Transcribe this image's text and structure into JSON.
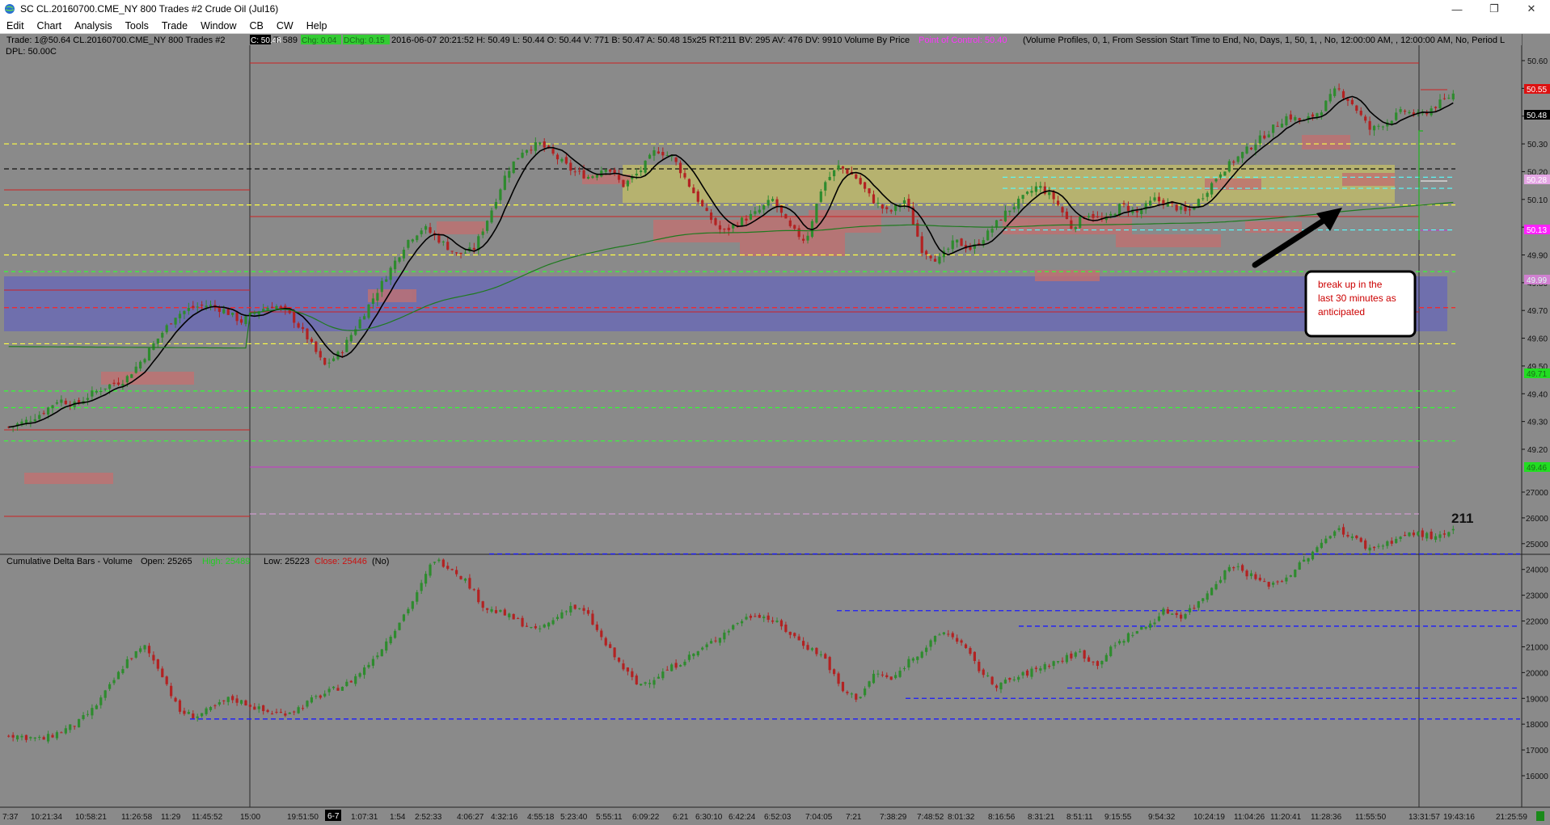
{
  "window": {
    "title": "SC CL.20160700.CME_NY  800 Trades  #2  Crude Oil (Jul16)",
    "min_glyph": "—",
    "max_glyph": "❐",
    "close_glyph": "✕"
  },
  "menu": [
    "Edit",
    "Chart",
    "Analysis",
    "Tools",
    "Trade",
    "Window",
    "CB",
    "CW",
    "Help"
  ],
  "info_bar": {
    "prefix": "Trade: 1@50.64  CL.20160700.CME_NY  800 Trades  #2",
    "c_badge": "C: 50.48",
    "t_text": "T: 589",
    "chg_badge": "Chg: 0.04",
    "dchg_badge": "DChg: 0.15",
    "details": "2016-06-07 20:21:52  H: 50.49  L: 50.44  O: 50.44  V: 771  B: 50.47  A: 50.48  15x25  RT:211  BV: 295  AV: 476  DV: 9910  Volume By Price",
    "poc": "Point of Control: 50.40",
    "profile": "(Volume Profiles, 0, 1, From Session Start Time to End, No, Days, 1, 50, 1, , No, 12:00:00 AM, , 12:00:00 AM, No, Period L",
    "dpl": "DPL: 50.00C"
  },
  "annotation": {
    "text_lines": [
      "break up in the",
      "last 30 minutes as",
      "anticipated"
    ],
    "bar_counter": "211"
  },
  "price_labels": {
    "red": "50.55",
    "last": "50.48",
    "pink": "50.28",
    "magenta": "50.13",
    "cyan": "49.99",
    "red2": "49.71",
    "green": "49.46"
  },
  "lower_pane": {
    "title": "Cumulative Delta Bars - Volume",
    "open": "Open: 25265",
    "high": "High: 25489",
    "low": "Low: 25223",
    "close": "Close: 25446",
    "no": "(No)"
  },
  "time_axis": {
    "labels": [
      "7:37",
      "10:21:34",
      "10:58:21",
      "11:26:58",
      "11:29",
      "11:45:52",
      "15:00",
      "19:51:50",
      "6-7",
      "1:07:31",
      "1:54",
      "2:52:33",
      "4:06:27",
      "4:32:16",
      "4:55:18",
      "5:23:40",
      "5:55:11",
      "6:09:22",
      "6:21",
      "6:30:10",
      "6:42:24",
      "6:52:03",
      "7:04:05",
      "7:21",
      "7:38:29",
      "7:48:52",
      "8:01:32",
      "8:16:56",
      "8:31:21",
      "8:51:11",
      "9:15:55",
      "9:54:32",
      "10:24:19",
      "11:04:26",
      "11:20:41",
      "11:28:36",
      "11:55:50",
      "13:31:57",
      "19:43:16",
      "21:25:59"
    ]
  },
  "colors": {
    "chart_bg": "#8a8a8a",
    "up_candle": "#2e8b2e",
    "down_candle": "#b22222",
    "value_area": "#6b6bb0",
    "yellow_zone": "#bdb86a",
    "volume_block": "#c07070",
    "ma_line": "#000000",
    "vwap_line": "#1f7a1f"
  },
  "chart_data": [
    {
      "type": "candlestick",
      "title": "CL.20160700.CME_NY 800 Trades #2",
      "ylim": [
        49.18,
        50.68
      ],
      "y_ticks": [
        "50.60",
        "50.50",
        "50.40",
        "50.30",
        "50.20",
        "50.10",
        "50.00",
        "49.90",
        "49.80",
        "49.70",
        "49.60",
        "49.50",
        "49.40",
        "49.30",
        "49.20"
      ],
      "close_path": [
        49.28,
        49.3,
        49.33,
        49.38,
        49.36,
        49.4,
        49.43,
        49.45,
        49.52,
        49.6,
        49.68,
        49.71,
        49.72,
        49.7,
        49.66,
        49.7,
        49.72,
        49.68,
        49.6,
        49.5,
        49.55,
        49.65,
        49.75,
        49.85,
        49.95,
        50.0,
        49.95,
        49.9,
        49.92,
        50.05,
        50.2,
        50.28,
        50.3,
        50.25,
        50.2,
        50.18,
        50.22,
        50.15,
        50.2,
        50.28,
        50.25,
        50.15,
        50.05,
        49.98,
        50.02,
        50.05,
        50.1,
        50.0,
        49.95,
        50.15,
        50.22,
        50.18,
        50.1,
        50.05,
        50.1,
        49.92,
        49.88,
        49.95,
        49.92,
        49.98,
        50.05,
        50.1,
        50.15,
        50.1,
        50.0,
        50.05,
        50.02,
        50.08,
        50.05,
        50.1,
        50.08,
        50.05,
        50.12,
        50.2,
        50.25,
        50.3,
        50.35,
        50.4,
        50.38,
        50.42,
        50.5,
        50.44,
        50.35,
        50.38,
        50.42,
        50.4,
        50.44,
        50.48
      ],
      "levels": [
        {
          "price": 50.3,
          "style": "yellow-dash"
        },
        {
          "price": 50.21,
          "style": "black-dash"
        },
        {
          "price": 50.18,
          "style": "cyan-dash"
        },
        {
          "price": 50.14,
          "style": "cyan-dash"
        },
        {
          "price": 50.08,
          "style": "yellow-dash"
        },
        {
          "price": 49.99,
          "style": "cyan-dash"
        },
        {
          "price": 49.9,
          "style": "yellow-dash"
        },
        {
          "price": 49.84,
          "style": "green-dash"
        },
        {
          "price": 49.71,
          "style": "red-dash"
        },
        {
          "price": 49.58,
          "style": "yellow-dash"
        },
        {
          "price": 49.41,
          "style": "green-dash"
        },
        {
          "price": 49.35,
          "style": "green-dash"
        },
        {
          "price": 49.23,
          "style": "green-dash"
        }
      ]
    },
    {
      "type": "candlestick",
      "title": "Cumulative Delta Bars - Volume",
      "ylim": [
        15500,
        27500
      ],
      "y_ticks": [
        "27000",
        "26000",
        "25000",
        "24000",
        "23000",
        "22000",
        "21000",
        "20000",
        "19000",
        "18000",
        "17000",
        "16000"
      ],
      "close_path": [
        17600,
        17500,
        17400,
        17700,
        18000,
        18600,
        19500,
        20500,
        21000,
        20000,
        18500,
        18300,
        18600,
        19000,
        18800,
        18500,
        18400,
        18600,
        19000,
        19300,
        19600,
        20200,
        21000,
        22000,
        23000,
        24400,
        24100,
        23500,
        22500,
        22300,
        22000,
        21600,
        22000,
        22600,
        22300,
        21200,
        20300,
        19500,
        19800,
        20200,
        20600,
        21000,
        21500,
        22000,
        22300,
        22000,
        21500,
        21000,
        20600,
        19300,
        19000,
        20000,
        19700,
        20500,
        21000,
        21600,
        21200,
        20200,
        19500,
        19700,
        20000,
        20300,
        20500,
        20800,
        20300,
        21000,
        21500,
        21800,
        22400,
        22200,
        22700,
        23500,
        24200,
        23800,
        23400,
        23600,
        24200,
        24800,
        25600,
        25300,
        24800,
        25000,
        25300,
        25400,
        25200,
        25446
      ],
      "levels": [
        24600,
        22400,
        21800,
        19400,
        19000,
        18200
      ]
    }
  ]
}
